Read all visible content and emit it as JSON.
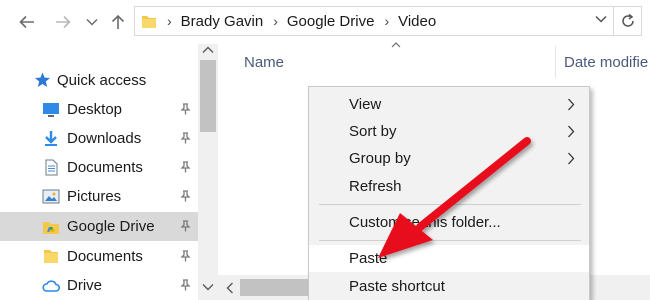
{
  "address_bar": {
    "breadcrumbs": [
      "Brady Gavin",
      "Google Drive",
      "Video"
    ]
  },
  "nav_pane": {
    "items": [
      {
        "label": "Quick access",
        "icon": "star-icon",
        "pinned": false
      },
      {
        "label": "Desktop",
        "icon": "desktop-icon",
        "pinned": true
      },
      {
        "label": "Downloads",
        "icon": "download-icon",
        "pinned": true
      },
      {
        "label": "Documents",
        "icon": "documents-icon",
        "pinned": true
      },
      {
        "label": "Pictures",
        "icon": "pictures-icon",
        "pinned": true
      },
      {
        "label": "Google Drive",
        "icon": "google-drive-icon",
        "pinned": true,
        "selected": true
      },
      {
        "label": "Documents",
        "icon": "folder-icon",
        "pinned": true
      },
      {
        "label": "Drive",
        "icon": "cloud-icon",
        "pinned": true
      }
    ]
  },
  "file_list": {
    "columns": [
      "Name",
      "Date modifie"
    ]
  },
  "context_menu": {
    "items": [
      {
        "label": "View",
        "submenu": true
      },
      {
        "label": "Sort by",
        "submenu": true
      },
      {
        "label": "Group by",
        "submenu": true
      },
      {
        "label": "Refresh",
        "submenu": false
      },
      {
        "label": "Customise this folder...",
        "submenu": false
      },
      {
        "label": "Paste",
        "submenu": false,
        "highlighted": true
      },
      {
        "label": "Paste shortcut",
        "submenu": false
      }
    ]
  },
  "colors": {
    "accent_arrow": "#e8101a",
    "folder_yellow": "#f3c94b",
    "selection_gray": "#d9d9d9"
  }
}
